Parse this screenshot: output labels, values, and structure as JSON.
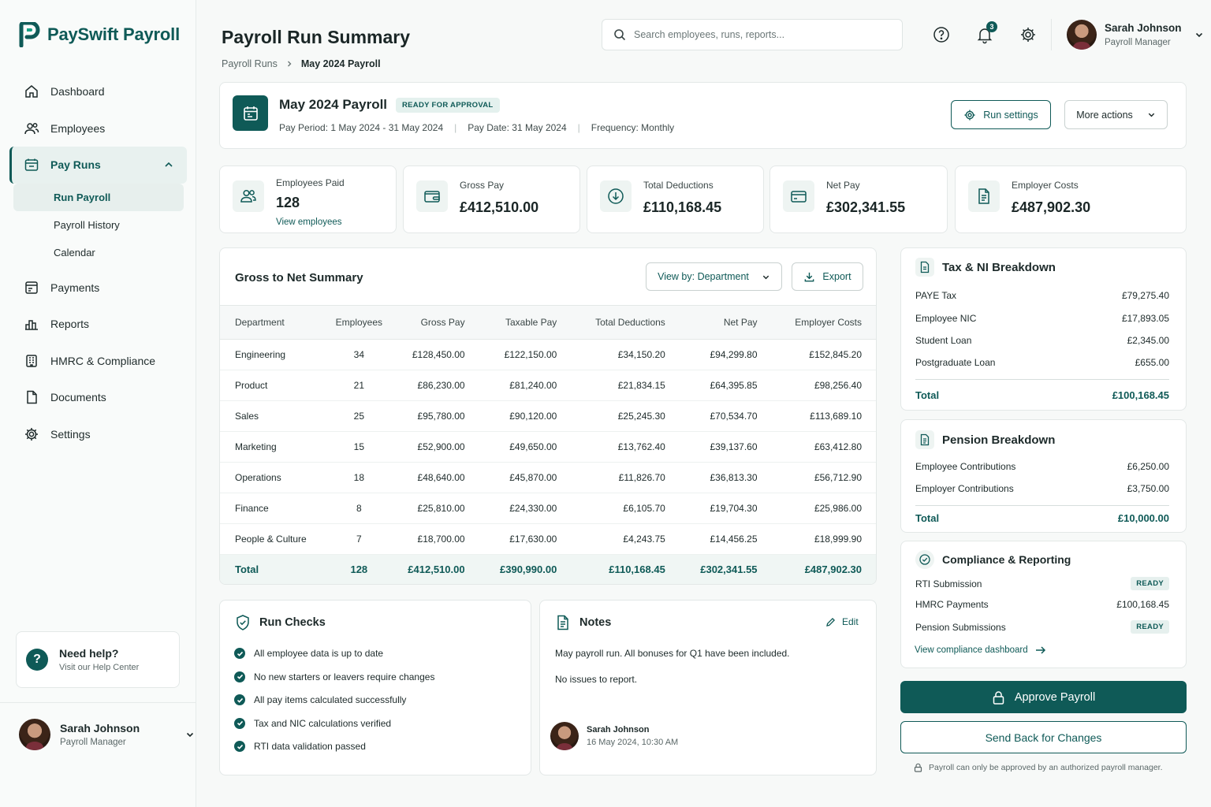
{
  "app": {
    "brand": "PaySwift Payroll",
    "accent": "#0f5a57"
  },
  "sidebar": {
    "items": [
      {
        "label": "Dashboard",
        "icon": "home-icon"
      },
      {
        "label": "Employees",
        "icon": "users-icon"
      },
      {
        "label": "Pay Runs",
        "icon": "payruns-icon"
      },
      {
        "label": "Payments",
        "icon": "payments-icon"
      },
      {
        "label": "Reports",
        "icon": "reports-icon"
      },
      {
        "label": "HMRC & Compliance",
        "icon": "building-icon"
      },
      {
        "label": "Documents",
        "icon": "document-icon"
      },
      {
        "label": "Settings",
        "icon": "gear-icon"
      }
    ],
    "sub_items": [
      "Run Payroll",
      "Payroll History",
      "Calendar"
    ],
    "help": {
      "title": "Need help?",
      "subtitle": "Visit our Help Center"
    },
    "user": {
      "name": "Sarah Johnson",
      "role": "Payroll Manager"
    }
  },
  "header": {
    "title": "Payroll Run Summary",
    "breadcrumb": [
      "Payroll Runs",
      "May 2024 Payroll"
    ],
    "search_placeholder": "Search employees, runs, reports...",
    "notification_count": "3",
    "user": {
      "name": "Sarah Johnson",
      "role": "Payroll Manager"
    }
  },
  "run": {
    "title": "May 2024 Payroll",
    "status": "READY FOR APPROVAL",
    "pay_period": "Pay Period: 1 May 2024 - 31 May 2024",
    "pay_date": "Pay Date: 31 May 2024",
    "frequency": "Frequency: Monthly",
    "settings_label": "Run settings",
    "more_label": "More actions"
  },
  "stats": [
    {
      "label": "Employees Paid",
      "value": "128",
      "link": "View employees"
    },
    {
      "label": "Gross Pay",
      "value": "£412,510.00"
    },
    {
      "label": "Total Deductions",
      "value": "£110,168.45"
    },
    {
      "label": "Net Pay",
      "value": "£302,341.55"
    },
    {
      "label": "Employer Costs",
      "value": "£487,902.30"
    }
  ],
  "summary": {
    "title": "Gross to Net Summary",
    "view_by": "View by: Department",
    "export": "Export",
    "columns": [
      "Department",
      "Employees",
      "Gross Pay",
      "Taxable Pay",
      "Total Deductions",
      "Net Pay",
      "Employer Costs"
    ],
    "rows": [
      [
        "Engineering",
        "34",
        "£128,450.00",
        "£122,150.00",
        "£34,150.20",
        "£94,299.80",
        "£152,845.20"
      ],
      [
        "Product",
        "21",
        "£86,230.00",
        "£81,240.00",
        "£21,834.15",
        "£64,395.85",
        "£98,256.40"
      ],
      [
        "Sales",
        "25",
        "£95,780.00",
        "£90,120.00",
        "£25,245.30",
        "£70,534.70",
        "£113,689.10"
      ],
      [
        "Marketing",
        "15",
        "£52,900.00",
        "£49,650.00",
        "£13,762.40",
        "£39,137.60",
        "£63,412.80"
      ],
      [
        "Operations",
        "18",
        "£48,640.00",
        "£45,870.00",
        "£11,826.70",
        "£36,813.30",
        "£56,712.90"
      ],
      [
        "Finance",
        "8",
        "£25,810.00",
        "£24,330.00",
        "£6,105.70",
        "£19,704.30",
        "£25,986.00"
      ],
      [
        "People & Culture",
        "7",
        "£18,700.00",
        "£17,630.00",
        "£4,243.75",
        "£14,456.25",
        "£18,999.90"
      ]
    ],
    "total": [
      "Total",
      "128",
      "£412,510.00",
      "£390,990.00",
      "£110,168.45",
      "£302,341.55",
      "£487,902.30"
    ]
  },
  "tax": {
    "title": "Tax & NI Breakdown",
    "rows": [
      {
        "label": "PAYE Tax",
        "value": "£79,275.40"
      },
      {
        "label": "Employee NIC",
        "value": "£17,893.05"
      },
      {
        "label": "Student Loan",
        "value": "£2,345.00"
      },
      {
        "label": "Postgraduate Loan",
        "value": "£655.00"
      }
    ],
    "total_label": "Total",
    "total_value": "£100,168.45"
  },
  "pension": {
    "title": "Pension Breakdown",
    "rows": [
      {
        "label": "Employee Contributions",
        "value": "£6,250.00"
      },
      {
        "label": "Employer Contributions",
        "value": "£3,750.00"
      }
    ],
    "total_label": "Total",
    "total_value": "£10,000.00"
  },
  "compliance": {
    "title": "Compliance & Reporting",
    "rti": {
      "label": "RTI Submission",
      "value": "READY"
    },
    "hmrc": {
      "label": "HMRC Payments",
      "value": "£100,168.45"
    },
    "pension": {
      "label": "Pension Submissions",
      "value": "READY"
    },
    "link": "View compliance dashboard"
  },
  "actions": {
    "approve": "Approve Payroll",
    "send_back": "Send Back for Changes",
    "note": "Payroll can only be approved by an authorized payroll manager."
  },
  "checks": {
    "title": "Run Checks",
    "items": [
      "All employee data is up to date",
      "No new starters or leavers require changes",
      "All pay items calculated successfully",
      "Tax and NIC calculations verified",
      "RTI data validation passed"
    ]
  },
  "notes": {
    "title": "Notes",
    "edit": "Edit",
    "line1": "May payroll run. All bonuses for Q1 have been included.",
    "line2": "No issues to report.",
    "author": "Sarah Johnson",
    "timestamp": "16 May 2024, 10:30 AM"
  }
}
